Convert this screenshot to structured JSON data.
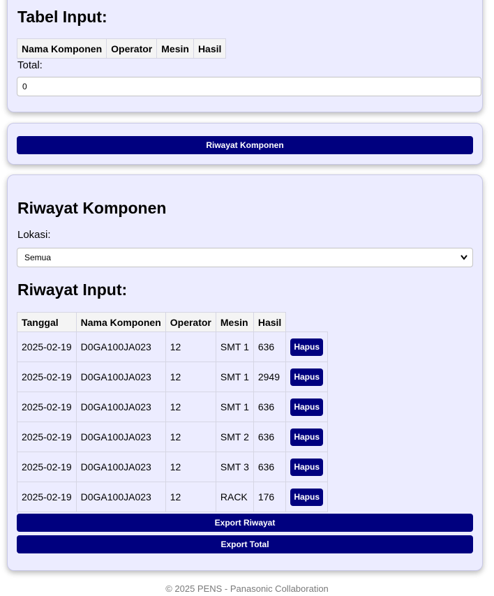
{
  "tabel_input": {
    "title": "Tabel Input:",
    "headers": [
      "Nama Komponen",
      "Operator",
      "Mesin",
      "Hasil"
    ],
    "total_label": "Total:",
    "total_value": "0"
  },
  "riwayat_button": {
    "label": "Riwayat Komponen"
  },
  "riwayat": {
    "title": "Riwayat Komponen",
    "lokasi_label": "Lokasi:",
    "lokasi_selected": "Semua",
    "input_title": "Riwayat Input:",
    "headers": [
      "Tanggal",
      "Nama Komponen",
      "Operator",
      "Mesin",
      "Hasil"
    ],
    "rows": [
      {
        "tanggal": "2025-02-19",
        "nama": "D0GA100JA023",
        "operator": "12",
        "mesin": "SMT 1",
        "hasil": "636",
        "action": "Hapus"
      },
      {
        "tanggal": "2025-02-19",
        "nama": "D0GA100JA023",
        "operator": "12",
        "mesin": "SMT 1",
        "hasil": "2949",
        "action": "Hapus"
      },
      {
        "tanggal": "2025-02-19",
        "nama": "D0GA100JA023",
        "operator": "12",
        "mesin": "SMT 1",
        "hasil": "636",
        "action": "Hapus"
      },
      {
        "tanggal": "2025-02-19",
        "nama": "D0GA100JA023",
        "operator": "12",
        "mesin": "SMT 2",
        "hasil": "636",
        "action": "Hapus"
      },
      {
        "tanggal": "2025-02-19",
        "nama": "D0GA100JA023",
        "operator": "12",
        "mesin": "SMT 3",
        "hasil": "636",
        "action": "Hapus"
      },
      {
        "tanggal": "2025-02-19",
        "nama": "D0GA100JA023",
        "operator": "12",
        "mesin": "RACK",
        "hasil": "176",
        "action": "Hapus"
      }
    ],
    "export_riwayat_label": "Export Riwayat",
    "export_total_label": "Export Total"
  },
  "footer": {
    "text": "© 2025 PENS - Panasonic Collaboration"
  },
  "colors": {
    "primary": "#00007f",
    "card_bg": "#ececff"
  },
  "icons": {
    "select_chevron": "chevron-down-icon"
  }
}
